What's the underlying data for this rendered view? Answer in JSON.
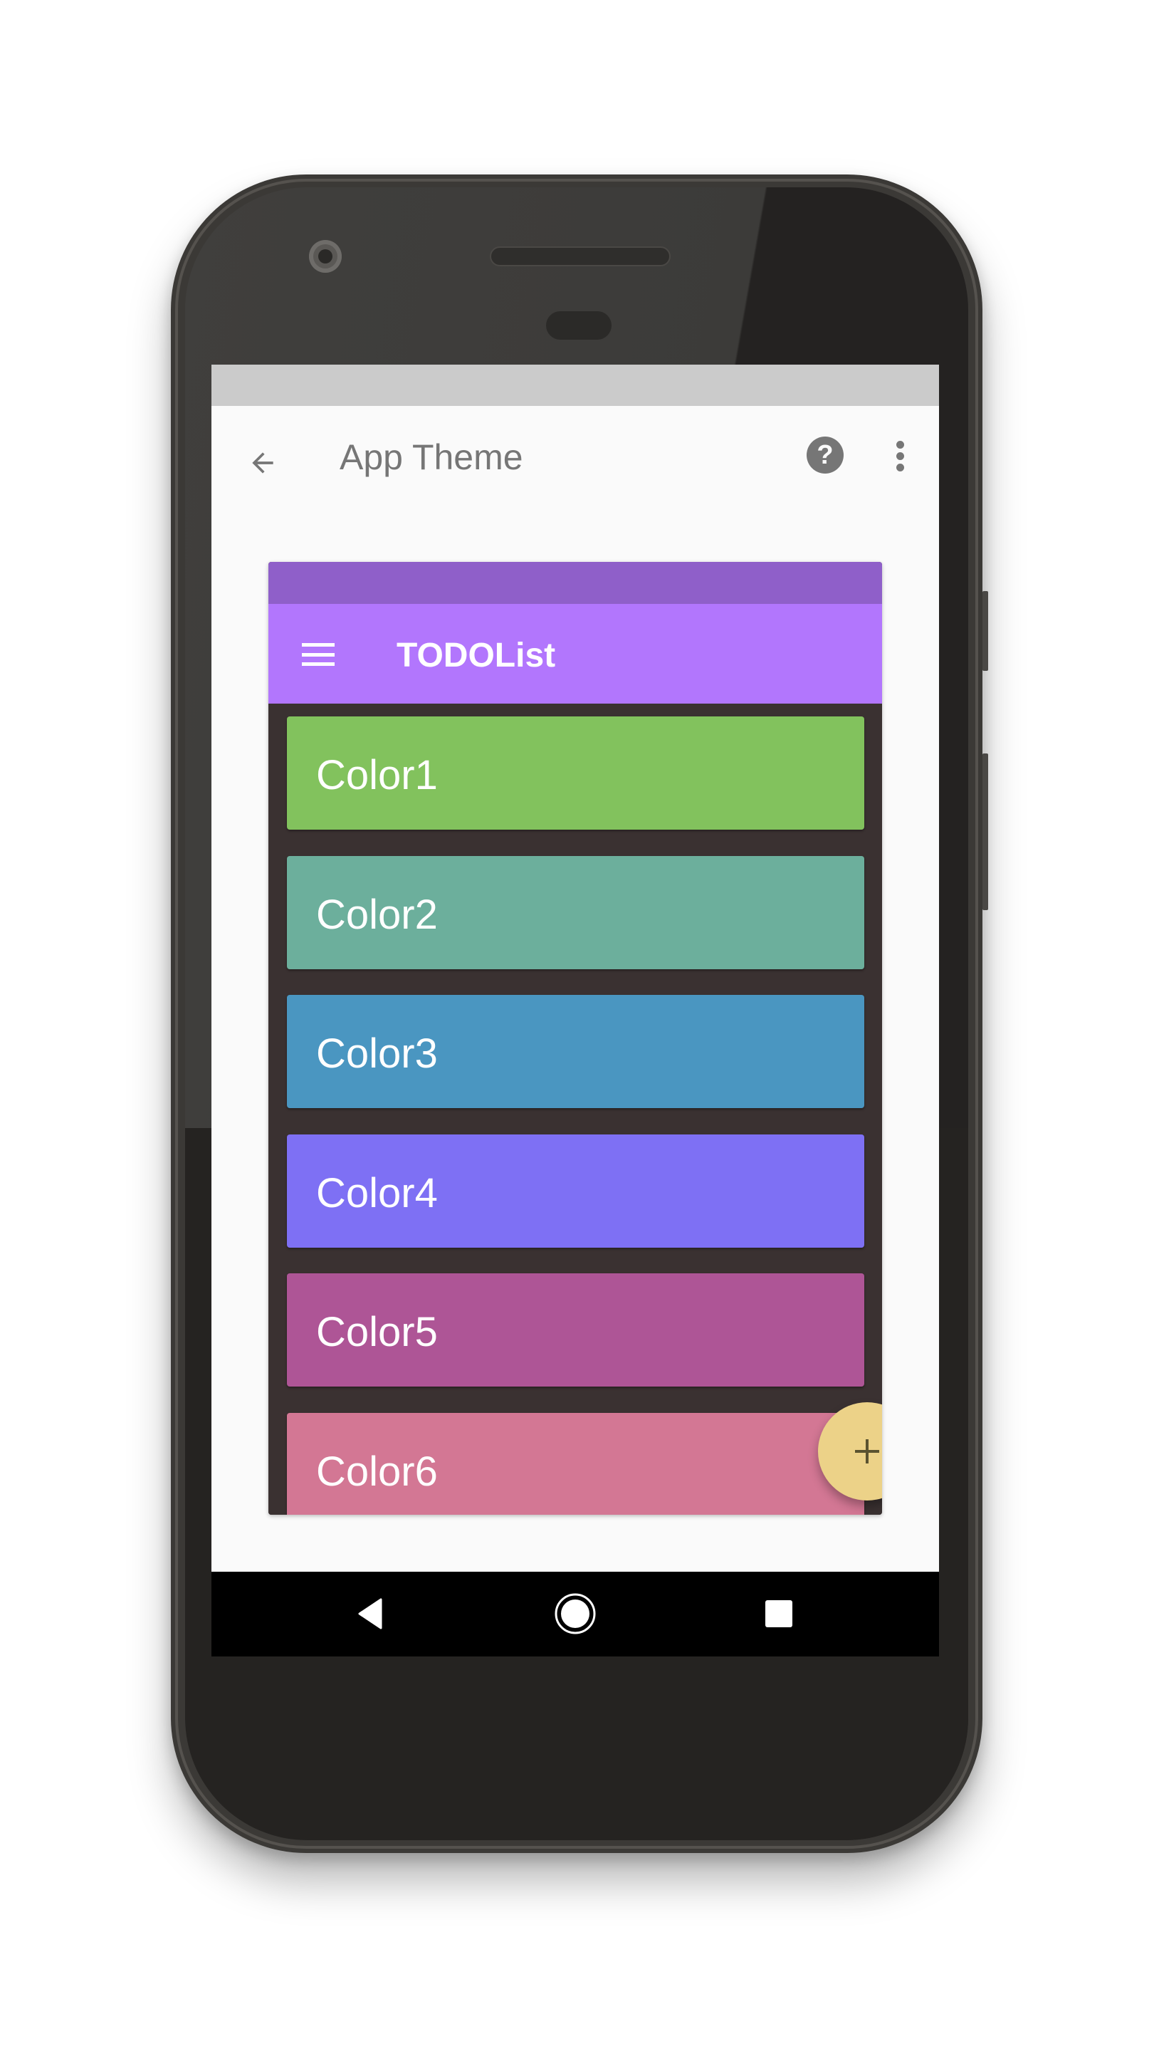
{
  "app_bar": {
    "title": "App Theme",
    "back_icon": "arrow-back-icon",
    "help_icon": "help-circle-icon",
    "help_glyph": "?",
    "overflow_icon": "more-vert-icon"
  },
  "preview": {
    "status_color": "#8f5fc9",
    "toolbar_color": "#b276fd",
    "list_background": "#3a3131",
    "menu_icon": "menu-icon",
    "title": "TODOList",
    "items": [
      {
        "label": "Color1",
        "color": "#82c25d"
      },
      {
        "label": "Color2",
        "color": "#6caf9c"
      },
      {
        "label": "Color3",
        "color": "#4a96c1"
      },
      {
        "label": "Color4",
        "color": "#7e70f4"
      },
      {
        "label": "Color5",
        "color": "#ae5596"
      },
      {
        "label": "Color6",
        "color": "#d37794"
      }
    ],
    "fab": {
      "icon": "add-icon",
      "color": "#ecd288",
      "icon_color": "#5b5330"
    }
  },
  "system": {
    "status_bar_color": "#cbcbcb",
    "nav_bar": {
      "back_icon": "nav-back-icon",
      "home_icon": "nav-home-icon",
      "recents_icon": "nav-recents-icon"
    }
  }
}
